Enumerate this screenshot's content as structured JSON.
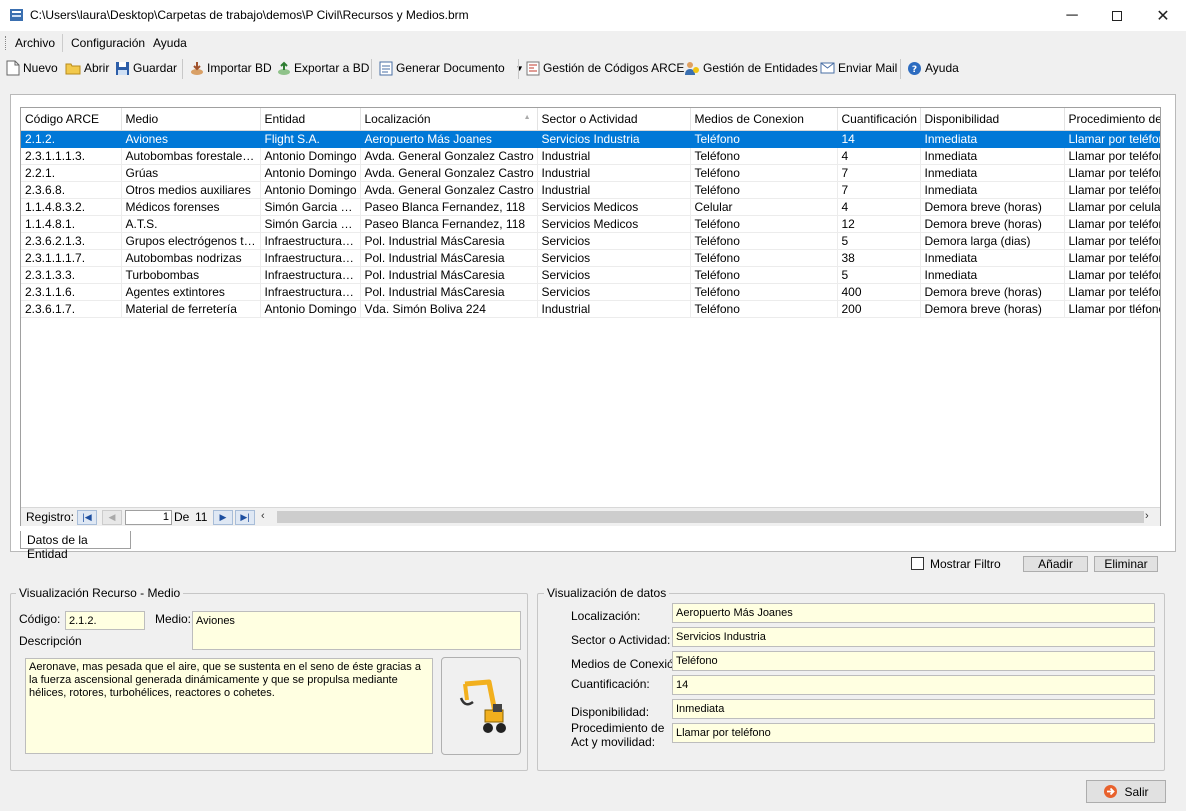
{
  "window": {
    "title": "C:\\Users\\laura\\Desktop\\Carpetas de trabajo\\demos\\P Civil\\Recursos y Medios.brm"
  },
  "menu": [
    "Archivo",
    "Configuración",
    "Ayuda"
  ],
  "toolbar": {
    "nuevo": "Nuevo",
    "abrir": "Abrir",
    "guardar": "Guardar",
    "importar": "Importar BD",
    "exportar": "Exportar a BD",
    "generar": "Generar Documento",
    "codigos": "Gestión de Códigos ARCE",
    "entidades": "Gestión de Entidades",
    "mail": "Enviar Mail",
    "ayuda": "Ayuda"
  },
  "grid": {
    "columns": [
      "Código ARCE",
      "Medio",
      "Entidad",
      "Localización",
      "Sector o Actividad",
      "Medios de Conexion",
      "Cuantificación",
      "Disponibilidad",
      "Procedimiento de"
    ],
    "rows": [
      [
        "2.1.2.",
        "Aviones",
        "Flight S.A.",
        "Aeropuerto Más Joanes",
        "Servicios Industria",
        "Teléfono",
        "14",
        "Inmediata",
        "Llamar por teléfono"
      ],
      [
        "2.3.1.1.1.3.",
        "Autobombas forestales li...",
        "Antonio Domingo",
        "Avda. General Gonzalez Castro",
        "Industrial",
        "Teléfono",
        "4",
        "Inmediata",
        "Llamar por teléfono"
      ],
      [
        "2.2.1.",
        "Grúas",
        "Antonio Domingo",
        "Avda. General Gonzalez Castro",
        "Industrial",
        "Teléfono",
        "7",
        "Inmediata",
        "Llamar por teléfono"
      ],
      [
        "2.3.6.8.",
        "Otros medios auxiliares",
        "Antonio Domingo",
        "Avda. General Gonzalez Castro",
        "Industrial",
        "Teléfono",
        "7",
        "Inmediata",
        "Llamar por teléfono"
      ],
      [
        "1.1.4.8.3.2.",
        "Médicos forenses",
        "Simón Garcia Ve...",
        "Paseo Blanca Fernandez, 118",
        "Servicios Medicos",
        "Celular",
        "4",
        "Demora breve (horas)",
        "Llamar por celular"
      ],
      [
        "1.1.4.8.1.",
        "A.T.S.",
        "Simón Garcia Ve...",
        "Paseo Blanca Fernandez, 118",
        "Servicios Medicos",
        "Teléfono",
        "12",
        "Demora breve (horas)",
        "Llamar por teléfono"
      ],
      [
        "2.3.6.2.1.3.",
        "Grupos electrógenos tra...",
        "Infraestructuras ...",
        "Pol. Industrial MásCaresia",
        "Servicios",
        "Teléfono",
        "5",
        "Demora larga (dias)",
        "Llamar por teléfono"
      ],
      [
        "2.3.1.1.1.7.",
        "Autobombas nodrizas",
        "Infraestructuras ...",
        "Pol. Industrial MásCaresia",
        "Servicios",
        "Teléfono",
        "38",
        "Inmediata",
        "Llamar por teléfono"
      ],
      [
        "2.3.1.3.3.",
        "Turbobombas",
        "Infraestructuras ...",
        "Pol. Industrial MásCaresia",
        "Servicios",
        "Teléfono",
        "5",
        "Inmediata",
        "Llamar por teléfono"
      ],
      [
        "2.3.1.1.6.",
        "Agentes extintores",
        "Infraestructuras ...",
        "Pol. Industrial MásCaresia",
        "Servicios",
        "Teléfono",
        "400",
        "Demora breve (horas)",
        "Llamar por teléfono"
      ],
      [
        "2.3.6.1.7.",
        "Material de ferretería",
        "Antonio Domingo",
        "Vda. Simón Boliva 224",
        "Industrial",
        "Teléfono",
        "200",
        "Demora breve (horas)",
        "Llamar por tléfono"
      ]
    ]
  },
  "nav": {
    "label": "Registro:",
    "current": "1",
    "of": "De",
    "total": "11"
  },
  "tab": "Datos de la Entidad",
  "filter": {
    "label": "Mostrar Filtro",
    "add": "Añadir",
    "delete": "Eliminar"
  },
  "recurso": {
    "title": "Visualización Recurso - Medio",
    "code_label": "Código:",
    "code": "2.1.2.",
    "medio_label": "Medio:",
    "medio": "Aviones",
    "desc_label": "Descripción",
    "desc": "Aeronave, mas pesada que el aire, que se sustenta en el seno de éste gracias a la fuerza ascensional generada dinámicamente y que se propulsa mediante hélices, rotores, turbohélices, reactores o cohetes."
  },
  "datos": {
    "title": "Visualización de datos",
    "fields": [
      {
        "label": "Localización:",
        "value": "Aeropuerto Más Joanes"
      },
      {
        "label": "Sector o Actividad:",
        "value": "Servicios Industria"
      },
      {
        "label": "Medios de Conexión",
        "value": "Teléfono"
      },
      {
        "label": "Cuantificación:",
        "value": "14"
      },
      {
        "label": "Disponibilidad:",
        "value": "Inmediata"
      },
      {
        "label": "Procedimiento de Act y movilidad:",
        "value": "Llamar por teléfono"
      }
    ]
  },
  "exit": "Salir"
}
